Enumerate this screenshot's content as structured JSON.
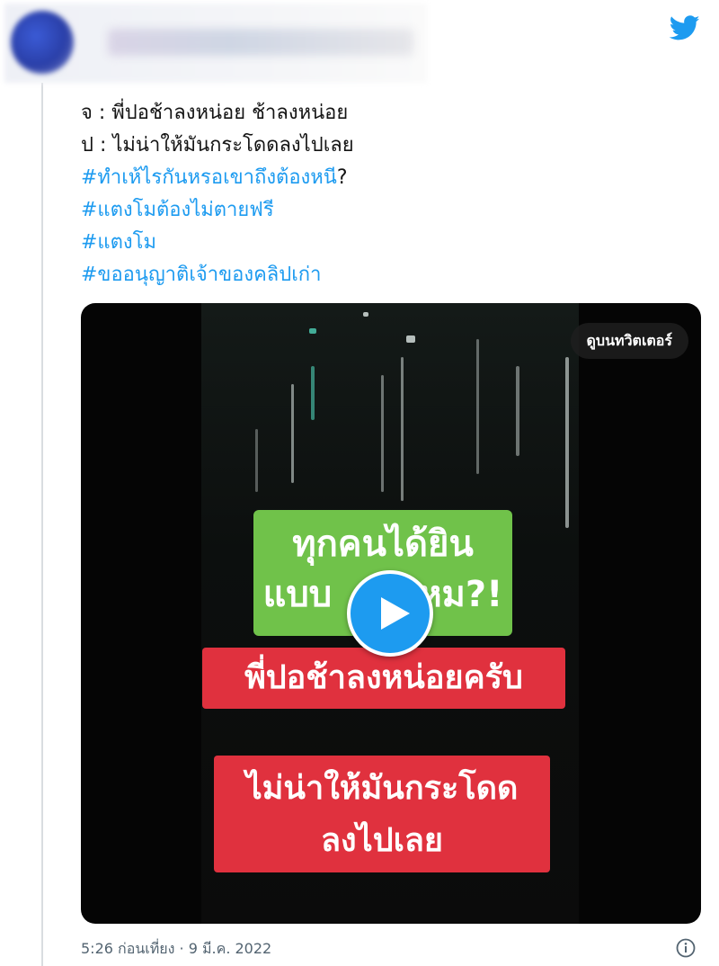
{
  "tweet": {
    "lines": [
      "จ : พี่ปอช้าลงหน่อย ช้าลงหน่อย",
      "ป : ไม่น่าให้มันกระโดดลงไปเลย"
    ],
    "hashtags": [
      {
        "text": "#ทำเห้ไรกันหรอเขาถึงต้องหนี",
        "suffix": "?"
      },
      {
        "text": "#แตงโมต้องไม่ตายฟรี",
        "suffix": ""
      },
      {
        "text": "#แตงโม",
        "suffix": ""
      },
      {
        "text": "#ขออนุญาติเจ้าของคลิปเก่า",
        "suffix": ""
      }
    ]
  },
  "media": {
    "watch_label": "ดูบนทวิตเตอร์",
    "caption_green": [
      "ทุกคนได้ยิน",
      "แบบ",
      "หม?!"
    ],
    "caption_red1": "พี่ปอช้าลงหน่อยครับ",
    "caption_red2": [
      "ไม่น่าให้มันกระโดด",
      "ลงไปเลย"
    ]
  },
  "footer": {
    "timestamp": "5:26 ก่อนเที่ยง · 9 มี.ค. 2022"
  },
  "colors": {
    "link": "#1d9bf0",
    "text": "#141414",
    "muted": "#536471",
    "caption_green": "#70c24a",
    "caption_red": "#e0313e"
  },
  "icons": [
    "twitter-bird-icon",
    "play-icon",
    "info-icon"
  ]
}
